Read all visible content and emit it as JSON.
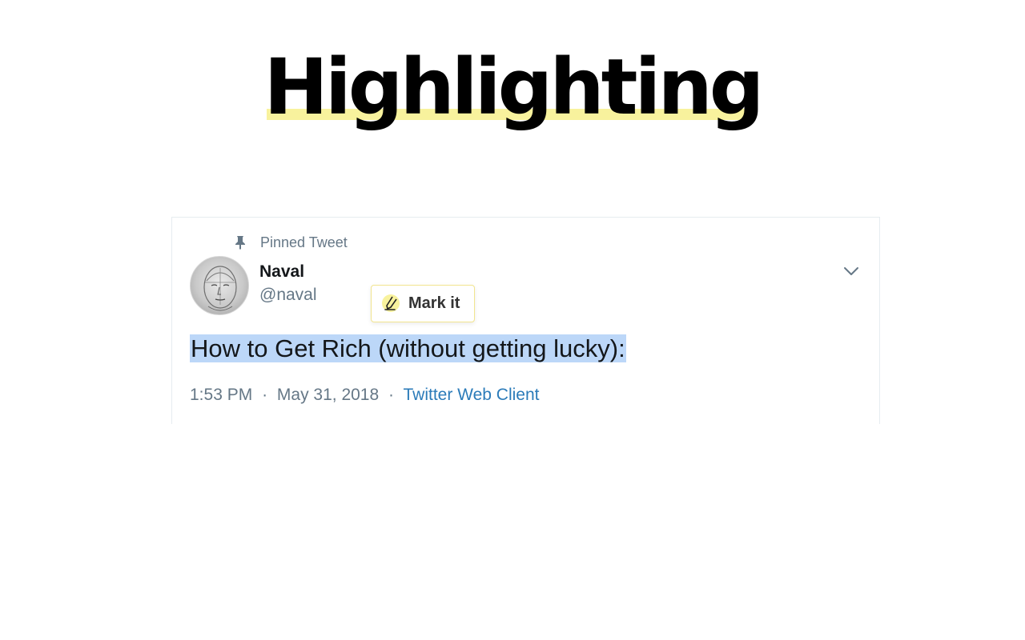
{
  "header": {
    "title": "Highlighting",
    "highlight_color": "#f8f29d"
  },
  "tweet": {
    "pinned_label": "Pinned Tweet",
    "author": {
      "name": "Naval",
      "handle": "@naval"
    },
    "text": "How to Get Rich (without getting lucky):",
    "selection_color": "#bcd7f8",
    "meta": {
      "time": "1:53 PM",
      "separator": "·",
      "date": "May 31, 2018",
      "source": "Twitter Web Client"
    },
    "icons": {
      "pin": "pin-icon",
      "menu": "chevron-down-icon"
    }
  },
  "popup": {
    "label": "Mark it",
    "icon": "mark-pen-icon",
    "accent": "#f8f29d"
  }
}
